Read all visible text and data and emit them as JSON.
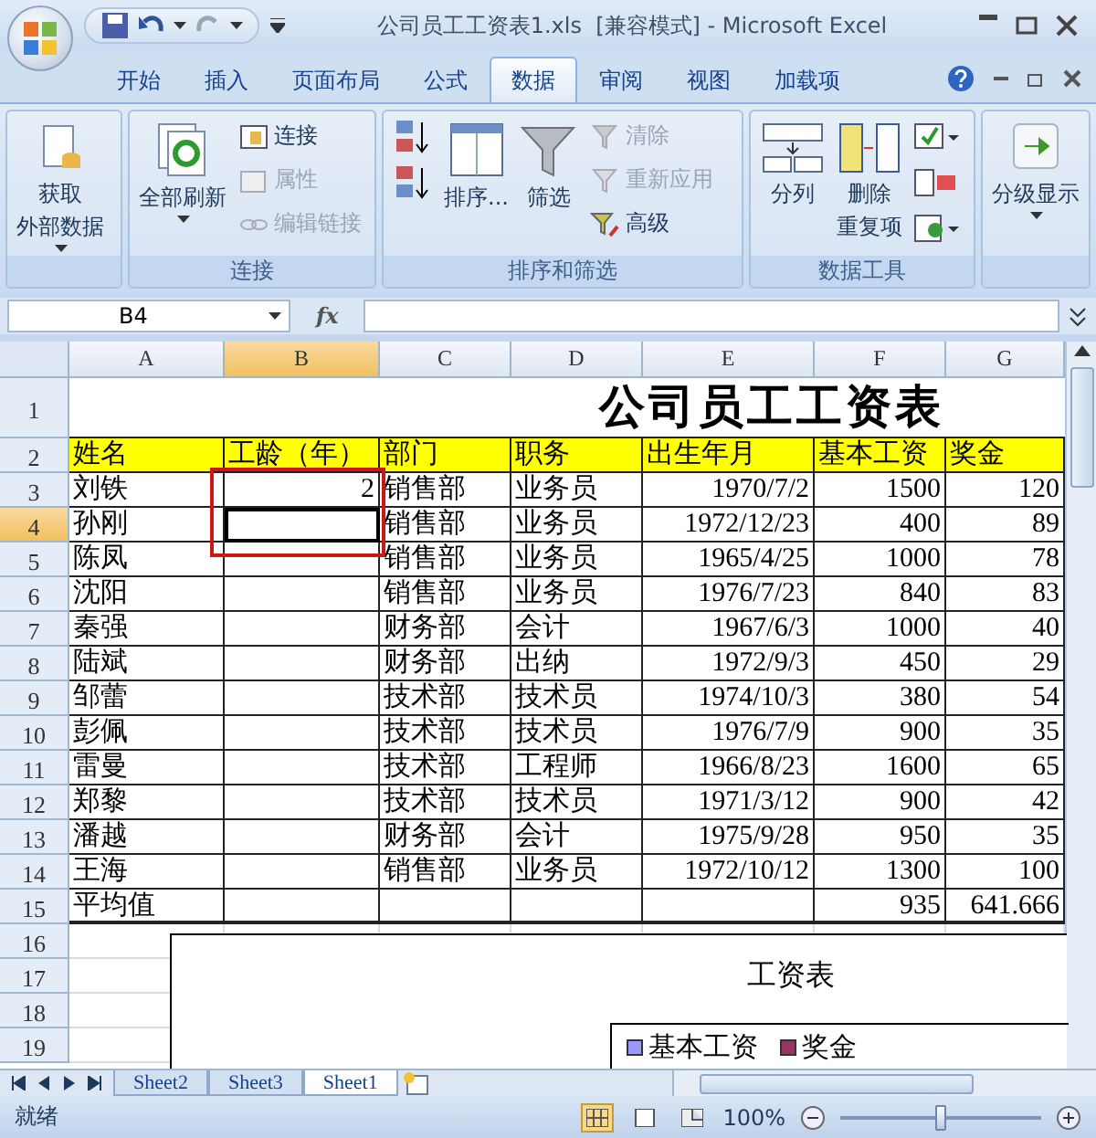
{
  "window": {
    "title": "公司员工工资表1.xls  [兼容模式] - Microsoft Excel"
  },
  "ribbon_tabs": [
    {
      "label": "开始",
      "selected": false
    },
    {
      "label": "插入",
      "selected": false
    },
    {
      "label": "页面布局",
      "selected": false
    },
    {
      "label": "公式",
      "selected": false
    },
    {
      "label": "数据",
      "selected": true
    },
    {
      "label": "审阅",
      "selected": false
    },
    {
      "label": "视图",
      "selected": false
    },
    {
      "label": "加载项",
      "selected": false
    }
  ],
  "ribbon_groups": [
    {
      "columns": [
        [
          {
            "kind": "large",
            "label": [
              "获取",
              "外部数据"
            ],
            "dropdown": true,
            "disabled": false
          }
        ]
      ]
    },
    {
      "label": "连接",
      "columns": [
        [
          {
            "kind": "large",
            "label": [
              "全部刷新"
            ],
            "dropdown": true,
            "disabled": false
          }
        ],
        [
          {
            "kind": "small",
            "label": "连接",
            "disabled": false
          },
          {
            "kind": "small",
            "label": "属性",
            "disabled": true
          },
          {
            "kind": "small",
            "label": "编辑链接",
            "disabled": true
          }
        ]
      ]
    },
    {
      "label": "排序和筛选",
      "columns": [
        [
          {
            "kind": "icon",
            "disabled": false
          },
          {
            "kind": "icon",
            "disabled": false
          }
        ],
        [
          {
            "kind": "large",
            "label": [
              "排序..."
            ],
            "dropdown": false,
            "disabled": false
          }
        ],
        [
          {
            "kind": "large",
            "label": [
              "筛选"
            ],
            "dropdown": false,
            "disabled": false
          }
        ],
        [
          {
            "kind": "small",
            "label": "清除",
            "disabled": true
          },
          {
            "kind": "small",
            "label": "重新应用",
            "disabled": true
          },
          {
            "kind": "small",
            "label": "高级",
            "disabled": false
          }
        ]
      ]
    },
    {
      "label": "数据工具",
      "columns": [
        [
          {
            "kind": "large",
            "label": [
              "分列"
            ],
            "dropdown": false,
            "disabled": false
          }
        ],
        [
          {
            "kind": "large",
            "label": [
              "删除",
              "重复项"
            ],
            "dropdown": false,
            "disabled": false
          }
        ],
        [
          {
            "kind": "icon",
            "disabled": false
          },
          {
            "kind": "icon",
            "disabled": false
          },
          {
            "kind": "icon",
            "disabled": false
          }
        ]
      ]
    },
    {
      "columns": [
        [
          {
            "kind": "large",
            "label": [
              "分级显示"
            ],
            "dropdown": true,
            "disabled": false
          }
        ]
      ]
    }
  ],
  "formula_bar": {
    "name_box": "B4",
    "fx": "fx"
  },
  "sheet": {
    "title": "公司员工工资表",
    "columns": [
      {
        "label": "A",
        "selected": false
      },
      {
        "label": "B",
        "selected": true
      },
      {
        "label": "C",
        "selected": false
      },
      {
        "label": "D",
        "selected": false
      },
      {
        "label": "E",
        "selected": false
      },
      {
        "label": "F",
        "selected": false
      },
      {
        "label": "G",
        "selected": false
      }
    ],
    "rows": [
      {
        "number": "1",
        "selected": false,
        "kind": "title"
      },
      {
        "number": "2",
        "selected": false,
        "kind": "header",
        "cells": [
          "姓名",
          "工龄（年）",
          "部门",
          "职务",
          "出生年月",
          "基本工资",
          "奖金"
        ]
      },
      {
        "number": "3",
        "selected": false,
        "kind": "data",
        "cells": [
          "刘铁",
          "2",
          "销售部",
          "业务员",
          "1970/7/2",
          "1500",
          "120"
        ]
      },
      {
        "number": "4",
        "selected": true,
        "kind": "data",
        "cells": [
          "孙刚",
          null,
          "销售部",
          "业务员",
          "1972/12/23",
          "400",
          "89"
        ]
      },
      {
        "number": "5",
        "selected": false,
        "kind": "data",
        "cells": [
          "陈凤",
          null,
          "销售部",
          "业务员",
          "1965/4/25",
          "1000",
          "78"
        ]
      },
      {
        "number": "6",
        "selected": false,
        "kind": "data",
        "cells": [
          "沈阳",
          null,
          "销售部",
          "业务员",
          "1976/7/23",
          "840",
          "83"
        ]
      },
      {
        "number": "7",
        "selected": false,
        "kind": "data",
        "cells": [
          "秦强",
          null,
          "财务部",
          "会计",
          "1967/6/3",
          "1000",
          "40"
        ]
      },
      {
        "number": "8",
        "selected": false,
        "kind": "data",
        "cells": [
          "陆斌",
          null,
          "财务部",
          "出纳",
          "1972/9/3",
          "450",
          "29"
        ]
      },
      {
        "number": "9",
        "selected": false,
        "kind": "data",
        "cells": [
          "邹蕾",
          null,
          "技术部",
          "技术员",
          "1974/10/3",
          "380",
          "54"
        ]
      },
      {
        "number": "10",
        "selected": false,
        "kind": "data",
        "cells": [
          "彭佩",
          null,
          "技术部",
          "技术员",
          "1976/7/9",
          "900",
          "35"
        ]
      },
      {
        "number": "11",
        "selected": false,
        "kind": "data",
        "cells": [
          "雷曼",
          null,
          "技术部",
          "工程师",
          "1966/8/23",
          "1600",
          "65"
        ]
      },
      {
        "number": "12",
        "selected": false,
        "kind": "data",
        "cells": [
          "郑黎",
          null,
          "技术部",
          "技术员",
          "1971/3/12",
          "900",
          "42"
        ]
      },
      {
        "number": "13",
        "selected": false,
        "kind": "data",
        "cells": [
          "潘越",
          null,
          "财务部",
          "会计",
          "1975/9/28",
          "950",
          "35"
        ]
      },
      {
        "number": "14",
        "selected": false,
        "kind": "data",
        "cells": [
          "王海",
          null,
          "销售部",
          "业务员",
          "1972/10/12",
          "1300",
          "100"
        ]
      },
      {
        "number": "15",
        "selected": false,
        "kind": "total",
        "cells": [
          "平均值",
          null,
          null,
          null,
          null,
          "935",
          "641.666"
        ]
      },
      {
        "number": "16",
        "selected": false,
        "kind": "empty"
      },
      {
        "number": "17",
        "selected": false,
        "kind": "empty"
      },
      {
        "number": "18",
        "selected": false,
        "kind": "empty"
      },
      {
        "number": "19",
        "selected": false,
        "kind": "empty"
      }
    ]
  },
  "chart": {
    "title": "工资表",
    "legend": [
      {
        "label": "基本工资",
        "color": "#9999ff"
      },
      {
        "label": "奖金",
        "color": "#993366"
      }
    ]
  },
  "sheet_tabs": [
    {
      "label": "Sheet2",
      "selected": false
    },
    {
      "label": "Sheet3",
      "selected": false
    },
    {
      "label": "Sheet1",
      "selected": true
    }
  ],
  "status_bar": {
    "status": "就绪",
    "zoom": "100%",
    "zoom_slider": {
      "level": 0.5
    }
  }
}
